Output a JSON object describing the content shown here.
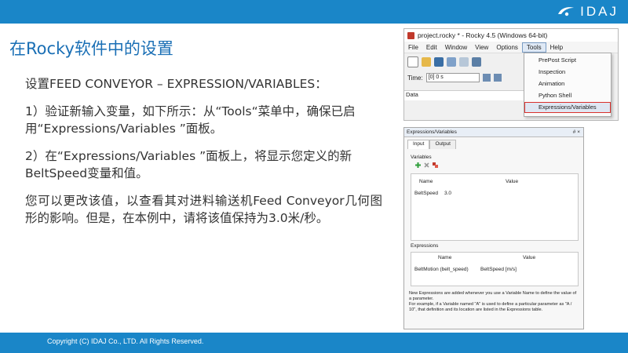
{
  "brand": {
    "logo_text": "IDAJ"
  },
  "slide": {
    "title": "在Rocky软件中的设置",
    "heading": "设置FEED CONVEYOR – EXPRESSION/VARIABLES：",
    "para1": "1）验证新输入变量，如下所示：从“Tools“菜单中，确保已启用“Expressions/Variables ”面板。",
    "para2": "2）在“Expressions/Variables ”面板上，将显示您定义的新BeltSpeed变量和值。",
    "para3": "您可以更改该值，以查看其对进料输送机Feed Conveyor几何图形的影响。但是，在本例中，请将该值保持为3.0米/秒。"
  },
  "footer": {
    "copyright": "Copyright (C) IDAJ Co., LTD. All Rights Reserved."
  },
  "rocky_window": {
    "title": "project.rocky * - Rocky 4.5 (Windows 64-bit)",
    "menu": [
      "File",
      "Edit",
      "Window",
      "View",
      "Options",
      "Tools",
      "Help"
    ],
    "active_menu": "Tools",
    "time_label": "Time:",
    "time_value": "[0] 0 s",
    "data_label": "Data",
    "tools_items": [
      "PrePost Script",
      "Inspection",
      "Animation",
      "Python Shell",
      "Expressions/Variables"
    ]
  },
  "expr_panel": {
    "title": "Expressions/Variables",
    "controls": "# ×",
    "tabs": [
      "Input",
      "Output"
    ],
    "variables_label": "Variables",
    "var_headers": [
      "Name",
      "Value"
    ],
    "var_name": "BeltSpeed",
    "var_value": "3.0",
    "expressions_label": "Expressions",
    "expr_headers": [
      "Name",
      "Value"
    ],
    "expr_name": "BeltMotion (belt_speed)",
    "expr_value": "BeltSpeed [m/s]",
    "note1": "New Expressions are added whenever you use a Variable Name to define the value of a parameter.",
    "note2": "For example, if a Variable named \"A\" is used to define a particular parameter as \"A / 10\", that definition and its location are listed in the Expressions table."
  },
  "colors": {
    "brand_blue": "#1a86c8",
    "title_blue": "#1a6fb5",
    "highlight_red": "#d9302c"
  }
}
